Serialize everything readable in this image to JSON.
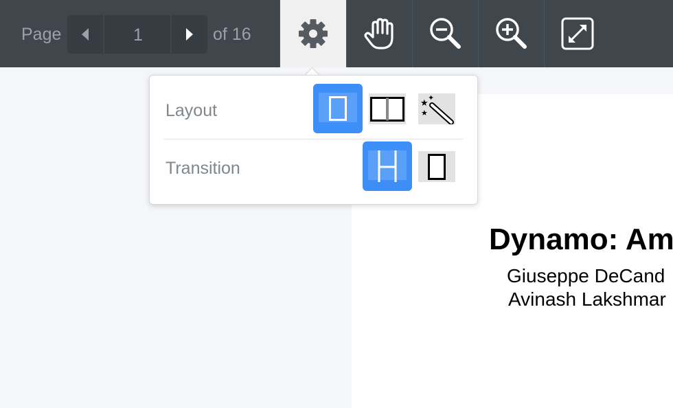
{
  "toolbar": {
    "page_label": "Page",
    "current_page": "1",
    "of_total": "of 16",
    "tools": [
      "gear-icon",
      "hand-icon",
      "zoom-out-icon",
      "zoom-in-icon",
      "fullscreen-icon"
    ]
  },
  "settings_popover": {
    "layout_label": "Layout",
    "transition_label": "Transition",
    "layout_options": [
      "single-page-icon",
      "two-page-icon",
      "magic-wand-icon"
    ],
    "layout_selected": "single-page-icon",
    "transition_options": [
      "vertical-scroll-icon",
      "page-flip-icon"
    ],
    "transition_selected": "vertical-scroll-icon"
  },
  "document": {
    "title": "Dynamo: Am",
    "authors": [
      "Giuseppe DeCand",
      "Avinash Lakshmar"
    ]
  },
  "colors": {
    "toolbar_bg": "#3f464c",
    "accent": "#3d8ef7",
    "active_tool_bg": "#f0f0f0"
  }
}
